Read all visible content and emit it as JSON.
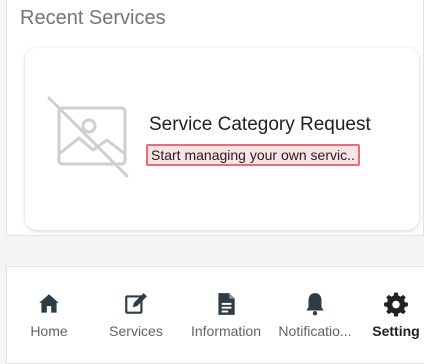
{
  "recent": {
    "title": "Recent Services",
    "card": {
      "title": "Service Category Request",
      "subtitle": "Start managing your own servic..",
      "image_icon": "image-placeholder-icon"
    }
  },
  "bottom_nav": {
    "items": [
      {
        "label": "Home",
        "icon": "home-icon"
      },
      {
        "label": "Services",
        "icon": "edit-icon"
      },
      {
        "label": "Information",
        "icon": "document-icon"
      },
      {
        "label": "Notificatio...",
        "icon": "bell-icon"
      },
      {
        "label": "Setting",
        "icon": "gear-icon",
        "active": true
      }
    ]
  },
  "colors": {
    "highlight_border": "#e86b75",
    "highlight_fill": "#fbe3e5",
    "icon_dark": "#2f3b45"
  }
}
